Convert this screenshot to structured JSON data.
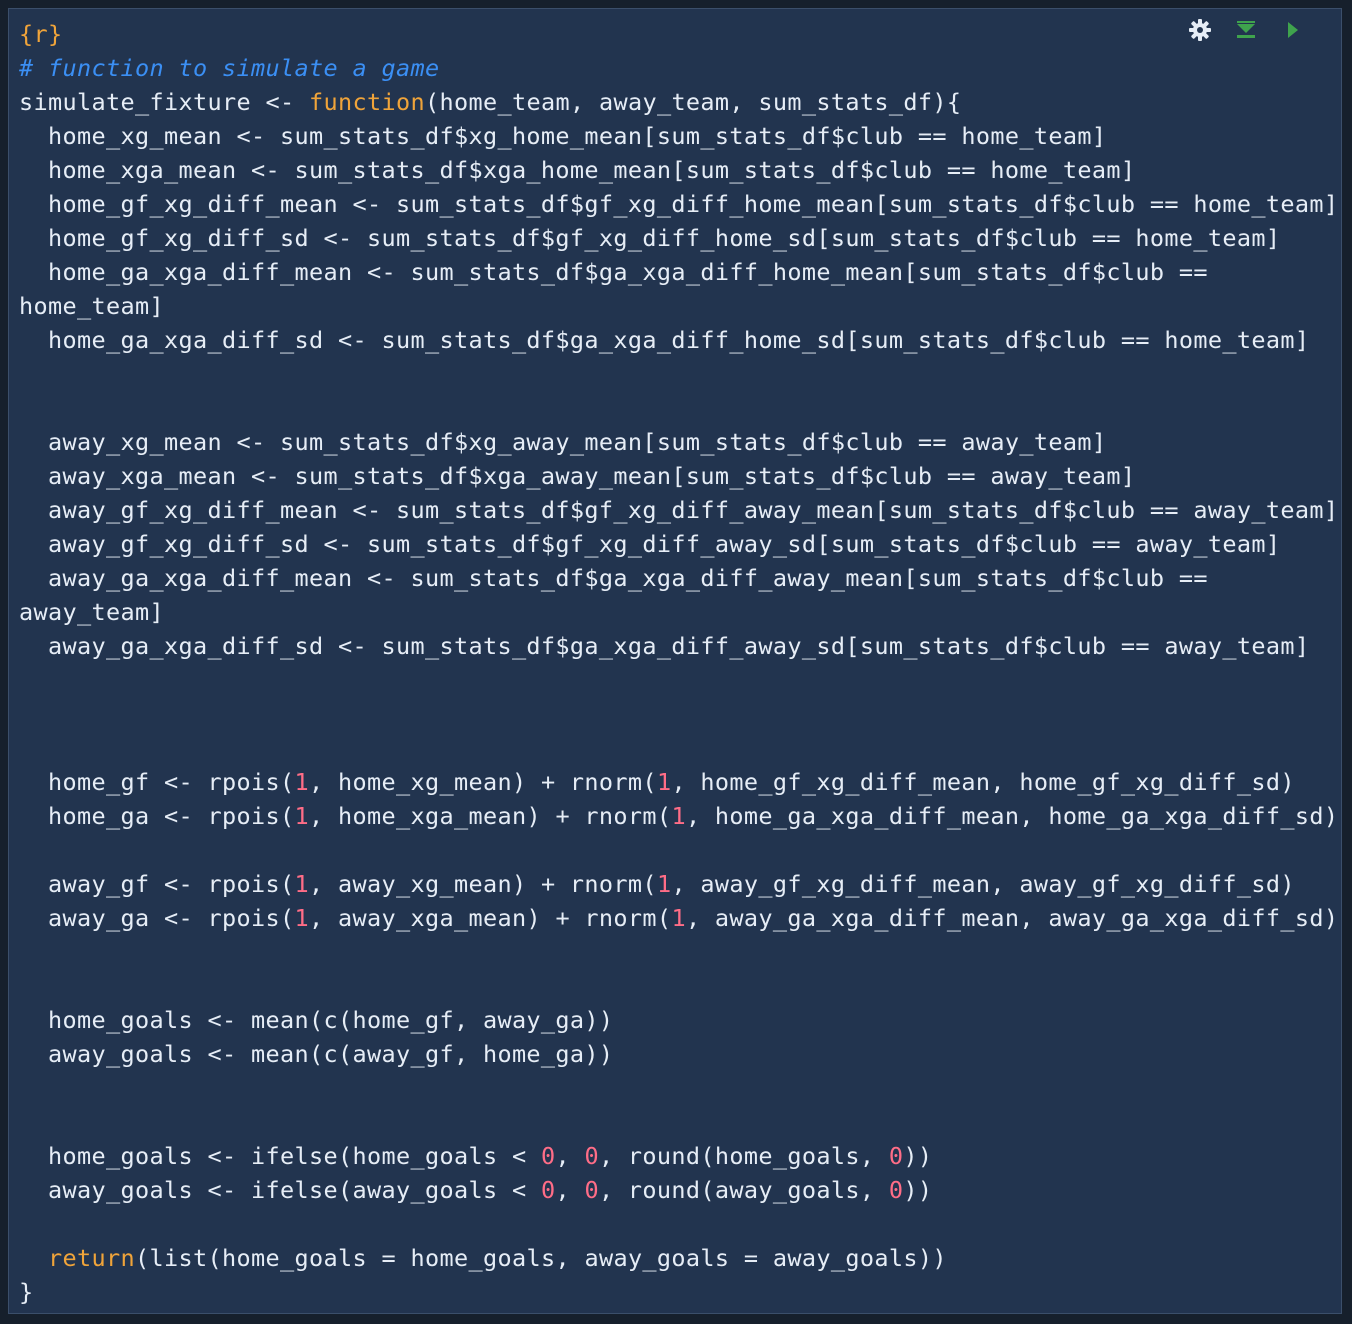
{
  "toolbar": {
    "icons": [
      "gear-icon",
      "run-above-icon",
      "run-chunk-icon"
    ]
  },
  "colors": {
    "background": "#22344f",
    "text": "#e6edf6",
    "keyword": "#f0a43a",
    "comment": "#3b8ff4",
    "number": "#ff6d87",
    "run_green": "#3fa34d"
  },
  "code": {
    "lines": [
      [
        {
          "t": "{r}",
          "c": "fn"
        }
      ],
      [
        {
          "t": "# function to simulate a game",
          "c": "com"
        }
      ],
      [
        {
          "t": "simulate_fixture <- ",
          "c": "plain"
        },
        {
          "t": "function",
          "c": "fn"
        },
        {
          "t": "(home_team, away_team, sum_stats_df){",
          "c": "plain"
        }
      ],
      [
        {
          "t": "  home_xg_mean <- sum_stats_df$xg_home_mean[sum_stats_df$club == home_team]",
          "c": "plain"
        }
      ],
      [
        {
          "t": "  home_xga_mean <- sum_stats_df$xga_home_mean[sum_stats_df$club == home_team]",
          "c": "plain"
        }
      ],
      [
        {
          "t": "  home_gf_xg_diff_mean <- sum_stats_df$gf_xg_diff_home_mean[sum_stats_df$club == home_team]",
          "c": "plain"
        }
      ],
      [
        {
          "t": "  home_gf_xg_diff_sd <- sum_stats_df$gf_xg_diff_home_sd[sum_stats_df$club == home_team]",
          "c": "plain"
        }
      ],
      [
        {
          "t": "  home_ga_xga_diff_mean <- sum_stats_df$ga_xga_diff_home_mean[sum_stats_df$club ==",
          "c": "plain"
        }
      ],
      [
        {
          "t": "home_team]",
          "c": "plain"
        }
      ],
      [
        {
          "t": "  home_ga_xga_diff_sd <- sum_stats_df$ga_xga_diff_home_sd[sum_stats_df$club == home_team]",
          "c": "plain"
        }
      ],
      [],
      [],
      [
        {
          "t": "  away_xg_mean <- sum_stats_df$xg_away_mean[sum_stats_df$club == away_team]",
          "c": "plain"
        }
      ],
      [
        {
          "t": "  away_xga_mean <- sum_stats_df$xga_away_mean[sum_stats_df$club == away_team]",
          "c": "plain"
        }
      ],
      [
        {
          "t": "  away_gf_xg_diff_mean <- sum_stats_df$gf_xg_diff_away_mean[sum_stats_df$club == away_team]",
          "c": "plain"
        }
      ],
      [
        {
          "t": "  away_gf_xg_diff_sd <- sum_stats_df$gf_xg_diff_away_sd[sum_stats_df$club == away_team]",
          "c": "plain"
        }
      ],
      [
        {
          "t": "  away_ga_xga_diff_mean <- sum_stats_df$ga_xga_diff_away_mean[sum_stats_df$club ==",
          "c": "plain"
        }
      ],
      [
        {
          "t": "away_team]",
          "c": "plain"
        }
      ],
      [
        {
          "t": "  away_ga_xga_diff_sd <- sum_stats_df$ga_xga_diff_away_sd[sum_stats_df$club == away_team]",
          "c": "plain"
        }
      ],
      [],
      [],
      [],
      [
        {
          "t": "  home_gf <- rpois(",
          "c": "plain"
        },
        {
          "t": "1",
          "c": "num"
        },
        {
          "t": ", home_xg_mean) + rnorm(",
          "c": "plain"
        },
        {
          "t": "1",
          "c": "num"
        },
        {
          "t": ", home_gf_xg_diff_mean, home_gf_xg_diff_sd)",
          "c": "plain"
        }
      ],
      [
        {
          "t": "  home_ga <- rpois(",
          "c": "plain"
        },
        {
          "t": "1",
          "c": "num"
        },
        {
          "t": ", home_xga_mean) + rnorm(",
          "c": "plain"
        },
        {
          "t": "1",
          "c": "num"
        },
        {
          "t": ", home_ga_xga_diff_mean, home_ga_xga_diff_sd)",
          "c": "plain"
        }
      ],
      [],
      [
        {
          "t": "  away_gf <- rpois(",
          "c": "plain"
        },
        {
          "t": "1",
          "c": "num"
        },
        {
          "t": ", away_xg_mean) + rnorm(",
          "c": "plain"
        },
        {
          "t": "1",
          "c": "num"
        },
        {
          "t": ", away_gf_xg_diff_mean, away_gf_xg_diff_sd)",
          "c": "plain"
        }
      ],
      [
        {
          "t": "  away_ga <- rpois(",
          "c": "plain"
        },
        {
          "t": "1",
          "c": "num"
        },
        {
          "t": ", away_xga_mean) + rnorm(",
          "c": "plain"
        },
        {
          "t": "1",
          "c": "num"
        },
        {
          "t": ", away_ga_xga_diff_mean, away_ga_xga_diff_sd)",
          "c": "plain"
        }
      ],
      [],
      [],
      [
        {
          "t": "  home_goals <- mean(c(home_gf, away_ga))",
          "c": "plain"
        }
      ],
      [
        {
          "t": "  away_goals <- mean(c(away_gf, home_ga))",
          "c": "plain"
        }
      ],
      [],
      [],
      [
        {
          "t": "  home_goals <- ifelse(home_goals < ",
          "c": "plain"
        },
        {
          "t": "0",
          "c": "num"
        },
        {
          "t": ", ",
          "c": "plain"
        },
        {
          "t": "0",
          "c": "num"
        },
        {
          "t": ", round(home_goals, ",
          "c": "plain"
        },
        {
          "t": "0",
          "c": "num"
        },
        {
          "t": "))",
          "c": "plain"
        }
      ],
      [
        {
          "t": "  away_goals <- ifelse(away_goals < ",
          "c": "plain"
        },
        {
          "t": "0",
          "c": "num"
        },
        {
          "t": ", ",
          "c": "plain"
        },
        {
          "t": "0",
          "c": "num"
        },
        {
          "t": ", round(away_goals, ",
          "c": "plain"
        },
        {
          "t": "0",
          "c": "num"
        },
        {
          "t": "))",
          "c": "plain"
        }
      ],
      [],
      [
        {
          "t": "  ",
          "c": "plain"
        },
        {
          "t": "return",
          "c": "fn"
        },
        {
          "t": "(list(home_goals = home_goals, away_goals = away_goals))",
          "c": "plain"
        }
      ],
      [
        {
          "t": "}",
          "c": "plain"
        }
      ]
    ]
  }
}
